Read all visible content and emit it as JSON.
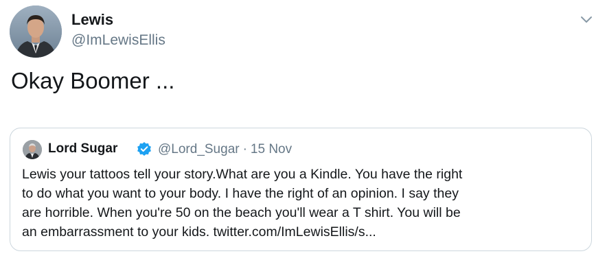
{
  "tweet": {
    "author_name": "Lewis",
    "author_handle": "@ImLewisEllis",
    "text": "Okay Boomer ...",
    "avatar_icon": "profile-photo",
    "menu_icon": "chevron-down-icon"
  },
  "quoted_tweet": {
    "author_name": "Lord Sugar",
    "verified": true,
    "verified_icon": "verified-badge-icon",
    "author_handle": "@Lord_Sugar",
    "separator": "·",
    "date": "15 Nov",
    "text_lines": [
      "Lewis your tattoos tell your story.What are you a Kindle. You have the right",
      "to do what you want to your body. I have the right of an opinion. I say they",
      "are horrible. When you're 50 on the beach you'll  wear a T shirt. You will be",
      "an embarrassment to your kids. twitter.com/ImLewisEllis/s..."
    ]
  },
  "colors": {
    "text_primary": "#14171a",
    "text_secondary": "#657786",
    "border": "#ccd6dd",
    "verified_blue": "#1da1f2"
  }
}
